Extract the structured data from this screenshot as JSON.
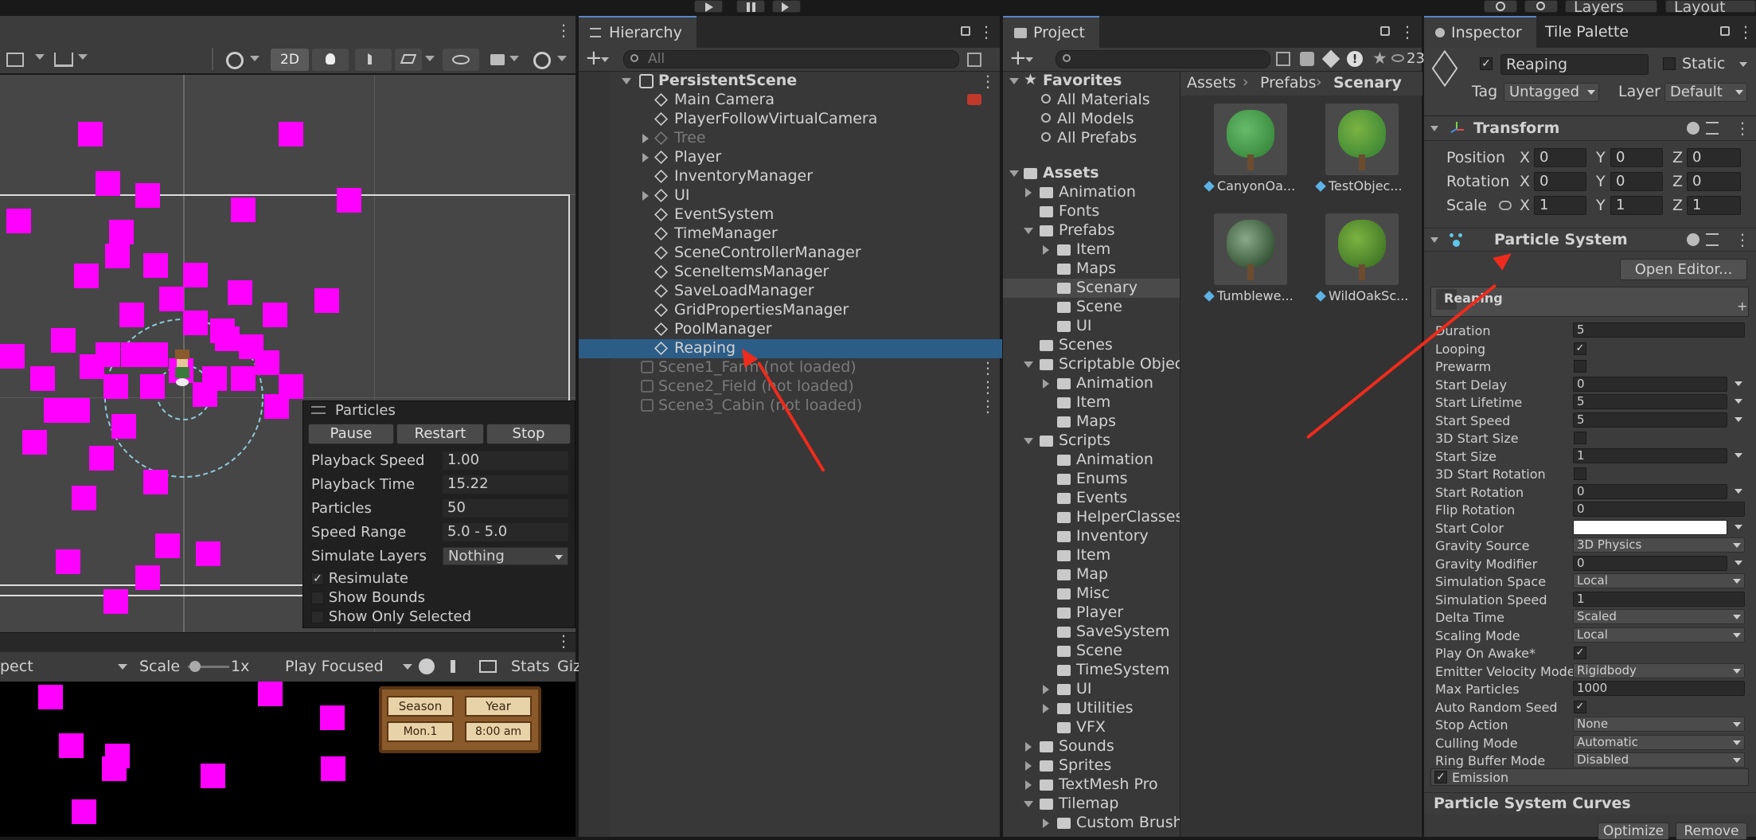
{
  "toolbar": {
    "layers_label": "Layers",
    "layout_label": "Layout"
  },
  "scene": {
    "mode_2d": "2D"
  },
  "hierarchy": {
    "tab": "Hierarchy",
    "search_placeholder": "All",
    "root": "PersistentScene",
    "items": [
      "Main Camera",
      "PlayerFollowVirtualCamera",
      "Tree",
      "Player",
      "InventoryManager",
      "UI",
      "EventSystem",
      "TimeManager",
      "SceneControllerManager",
      "SceneItemsManager",
      "SaveLoadManager",
      "GridPropertiesManager",
      "PoolManager",
      "Reaping"
    ],
    "unloaded": [
      "Scene1_Farm (not loaded)",
      "Scene2_Field (not loaded)",
      "Scene3_Cabin (not loaded)"
    ]
  },
  "particles": {
    "title": "Particles",
    "pause": "Pause",
    "restart": "Restart",
    "stop": "Stop",
    "rows": [
      {
        "label": "Playback Speed",
        "value": "1.00"
      },
      {
        "label": "Playback Time",
        "value": "15.22"
      },
      {
        "label": "Particles",
        "value": "50"
      },
      {
        "label": "Speed Range",
        "value": "5.0 - 5.0"
      },
      {
        "label": "Simulate Layers",
        "value": "Nothing"
      }
    ],
    "resimulate": "Resimulate",
    "show_bounds": "Show Bounds",
    "show_only_selected": "Show Only Selected"
  },
  "game": {
    "aspect": "pect",
    "scale_label": "Scale",
    "scale_value": "1x",
    "play_focused": "Play Focused",
    "stats": "Stats",
    "gizmos": "Giz",
    "hud": {
      "season": "Season",
      "year": "Year",
      "day": "Mon.1",
      "time": "8:00 am"
    }
  },
  "project": {
    "tab": "Project",
    "count": "23",
    "breadcrumb": [
      "Assets",
      "Prefabs",
      "Scenary"
    ],
    "favorites": "Favorites",
    "fav_items": [
      "All Materials",
      "All Models",
      "All Prefabs"
    ],
    "assets": "Assets",
    "tree": [
      {
        "label": "Animation",
        "indent": 1,
        "arrow": "right"
      },
      {
        "label": "Fonts",
        "indent": 1,
        "arrow": "none"
      },
      {
        "label": "Prefabs",
        "indent": 1,
        "arrow": "down"
      },
      {
        "label": "Item",
        "indent": 2,
        "arrow": "right"
      },
      {
        "label": "Maps",
        "indent": 2,
        "arrow": "none"
      },
      {
        "label": "Scenary",
        "indent": 2,
        "arrow": "none",
        "selected": true
      },
      {
        "label": "Scene",
        "indent": 2,
        "arrow": "none"
      },
      {
        "label": "UI",
        "indent": 2,
        "arrow": "none"
      },
      {
        "label": "Scenes",
        "indent": 1,
        "arrow": "none"
      },
      {
        "label": "Scriptable Objec",
        "indent": 1,
        "arrow": "down"
      },
      {
        "label": "Animation",
        "indent": 2,
        "arrow": "right"
      },
      {
        "label": "Item",
        "indent": 2,
        "arrow": "none"
      },
      {
        "label": "Maps",
        "indent": 2,
        "arrow": "none"
      },
      {
        "label": "Scripts",
        "indent": 1,
        "arrow": "down"
      },
      {
        "label": "Animation",
        "indent": 2,
        "arrow": "none"
      },
      {
        "label": "Enums",
        "indent": 2,
        "arrow": "none"
      },
      {
        "label": "Events",
        "indent": 2,
        "arrow": "none"
      },
      {
        "label": "HelperClasses",
        "indent": 2,
        "arrow": "none"
      },
      {
        "label": "Inventory",
        "indent": 2,
        "arrow": "none"
      },
      {
        "label": "Item",
        "indent": 2,
        "arrow": "none"
      },
      {
        "label": "Map",
        "indent": 2,
        "arrow": "none"
      },
      {
        "label": "Misc",
        "indent": 2,
        "arrow": "none"
      },
      {
        "label": "Player",
        "indent": 2,
        "arrow": "none"
      },
      {
        "label": "SaveSystem",
        "indent": 2,
        "arrow": "none"
      },
      {
        "label": "Scene",
        "indent": 2,
        "arrow": "none"
      },
      {
        "label": "TimeSystem",
        "indent": 2,
        "arrow": "none"
      },
      {
        "label": "UI",
        "indent": 2,
        "arrow": "right"
      },
      {
        "label": "Utilities",
        "indent": 2,
        "arrow": "right"
      },
      {
        "label": "VFX",
        "indent": 2,
        "arrow": "none"
      },
      {
        "label": "Sounds",
        "indent": 1,
        "arrow": "right"
      },
      {
        "label": "Sprites",
        "indent": 1,
        "arrow": "right"
      },
      {
        "label": "TextMesh Pro",
        "indent": 1,
        "arrow": "right"
      },
      {
        "label": "Tilemap",
        "indent": 1,
        "arrow": "down"
      },
      {
        "label": "Custom Brush",
        "indent": 2,
        "arrow": "right"
      }
    ],
    "assets_grid": [
      "CanyonOa...",
      "TestObjec...",
      "Tumblewe...",
      "WildOakSc..."
    ]
  },
  "inspector": {
    "tab": "Inspector",
    "tab2": "Tile Palette",
    "object_name": "Reaping",
    "static": "Static",
    "tag_label": "Tag",
    "tag_value": "Untagged",
    "layer_label": "Layer",
    "layer_value": "Default",
    "transform": {
      "title": "Transform",
      "rows": [
        {
          "label": "Position",
          "x": "0",
          "y": "0",
          "z": "0"
        },
        {
          "label": "Rotation",
          "x": "0",
          "y": "0",
          "z": "0"
        },
        {
          "label": "Scale",
          "x": "1",
          "y": "1",
          "z": "1"
        }
      ]
    },
    "ps": {
      "title": "Particle System",
      "open_editor": "Open Editor...",
      "module": "Reaping",
      "rows": [
        {
          "label": "Duration",
          "value": "5",
          "kind": "text"
        },
        {
          "label": "Looping",
          "value": "✓",
          "kind": "check"
        },
        {
          "label": "Prewarm",
          "value": "",
          "kind": "check"
        },
        {
          "label": "Start Delay",
          "value": "0",
          "kind": "textarrow"
        },
        {
          "label": "Start Lifetime",
          "value": "5",
          "kind": "textarrow"
        },
        {
          "label": "Start Speed",
          "value": "5",
          "kind": "textarrow"
        },
        {
          "label": "3D Start Size",
          "value": "",
          "kind": "check"
        },
        {
          "label": "Start Size",
          "value": "1",
          "kind": "textarrow"
        },
        {
          "label": "3D Start Rotation",
          "value": "",
          "kind": "check"
        },
        {
          "label": "Start Rotation",
          "value": "0",
          "kind": "textarrow"
        },
        {
          "label": "Flip Rotation",
          "value": "0",
          "kind": "text"
        },
        {
          "label": "Start Color",
          "value": "",
          "kind": "color"
        },
        {
          "label": "Gravity Source",
          "value": "3D Physics",
          "kind": "select"
        },
        {
          "label": "Gravity Modifier",
          "value": "0",
          "kind": "textarrow"
        },
        {
          "label": "Simulation Space",
          "value": "Local",
          "kind": "select"
        },
        {
          "label": "Simulation Speed",
          "value": "1",
          "kind": "text"
        },
        {
          "label": "Delta Time",
          "value": "Scaled",
          "kind": "select"
        },
        {
          "label": "Scaling Mode",
          "value": "Local",
          "kind": "select"
        },
        {
          "label": "Play On Awake*",
          "value": "✓",
          "kind": "check"
        },
        {
          "label": "Emitter Velocity Mode",
          "value": "Rigidbody",
          "kind": "select"
        },
        {
          "label": "Max Particles",
          "value": "1000",
          "kind": "text"
        },
        {
          "label": "Auto Random Seed",
          "value": "✓",
          "kind": "check"
        },
        {
          "label": "Stop Action",
          "value": "None",
          "kind": "select"
        },
        {
          "label": "Culling Mode",
          "value": "Automatic",
          "kind": "select"
        },
        {
          "label": "Ring Buffer Mode",
          "value": "Disabled",
          "kind": "select"
        }
      ],
      "emission": "Emission",
      "curves": "Particle System Curves",
      "optimize": "Optimize",
      "remove": "Remove"
    }
  },
  "colors": {
    "accent": "#2c5d87",
    "particle": "#ff00ff",
    "arrow": "#ee2b1c"
  }
}
